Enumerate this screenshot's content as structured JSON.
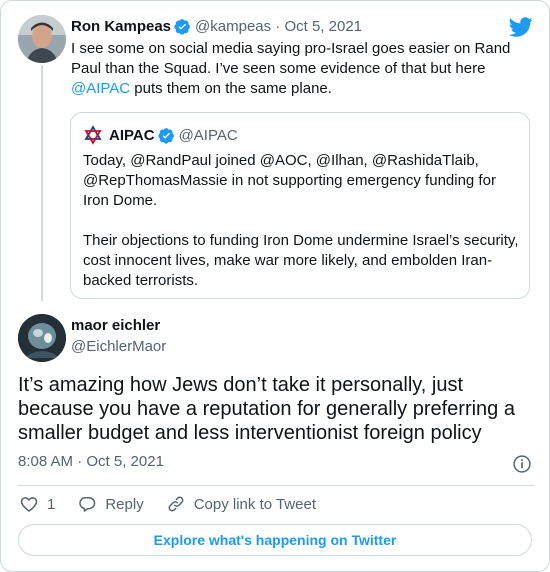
{
  "original_tweet": {
    "author_name": "Ron Kampeas",
    "handle_date": "@kampeas · Oct 5, 2021",
    "text_before_link": "I see some on social media saying pro-Israel goes easier on Rand Paul than the Squad. I’ve seen some evidence of that but here ",
    "link_mention": "@AIPAC",
    "text_after_link": " puts them on the same plane."
  },
  "quoted_tweet": {
    "author_name": "AIPAC",
    "handle": "@AIPAC",
    "text": "Today, @RandPaul joined @AOC, @Ilhan, @RashidaTlaib, @RepThomasMassie in not supporting emergency funding for Iron Dome.\n\nTheir objections to funding Iron Dome undermine Israel’s security, cost innocent lives, make war more likely, and embolden Iran-backed terrorists."
  },
  "reply_tweet": {
    "author_name": "maor eichler",
    "handle": "@EichlerMaor",
    "text": "It’s amazing how Jews don’t take it personally, just because you have a reputation for generally preferring a smaller budget and less interventionist foreign policy",
    "timestamp": "8:08 AM · Oct 5, 2021"
  },
  "actions": {
    "like_count": "1",
    "reply_label": "Reply",
    "copy_link_label": "Copy link to Tweet"
  },
  "footer": {
    "explore_label": "Explore what's happening on Twitter"
  },
  "colors": {
    "accent": "#1d9bf0",
    "text": "#0f1419",
    "secondary": "#536471",
    "border": "#cfd9de"
  },
  "icons": [
    "twitter-bird-icon",
    "verified-badge-icon",
    "aipac-logo-icon",
    "info-icon",
    "heart-icon",
    "reply-icon",
    "link-icon"
  ]
}
